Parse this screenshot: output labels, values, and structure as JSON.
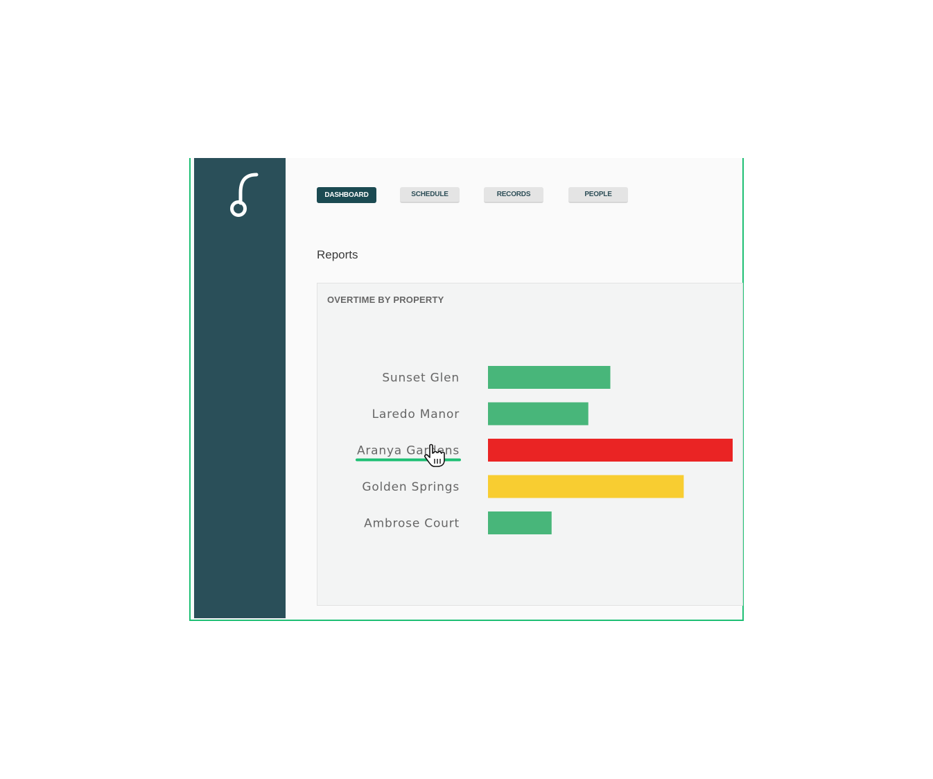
{
  "nav": {
    "tabs": [
      {
        "label": "DASHBOARD",
        "active": true
      },
      {
        "label": "SCHEDULE",
        "active": false
      },
      {
        "label": "RECORDS",
        "active": false
      },
      {
        "label": "PEOPLE",
        "active": false
      }
    ]
  },
  "page": {
    "title": "Reports"
  },
  "report": {
    "title": "OVERTIME BY PROPERTY",
    "hovered_item": "Aranya Gardens"
  },
  "colors": {
    "sidebar": "#2a4f59",
    "accent": "#1dbf73",
    "status_ok": "#48b67a",
    "status_warning": "#f8cd31",
    "status_critical": "#ea2424"
  },
  "chart_data": {
    "type": "bar",
    "orientation": "horizontal",
    "title": "OVERTIME BY PROPERTY",
    "categories": [
      "Sunset Glen",
      "Laredo Manor",
      "Aranya Gardens",
      "Golden Springs",
      "Ambrose Court"
    ],
    "values": [
      50,
      41,
      100,
      80,
      26
    ],
    "value_unit": "relative (percent of longest bar, no axis shown)",
    "bar_colors": [
      "#48b67a",
      "#48b67a",
      "#ea2424",
      "#f8cd31",
      "#48b67a"
    ],
    "xlim": [
      0,
      100
    ],
    "grid": false,
    "legend": "none"
  }
}
